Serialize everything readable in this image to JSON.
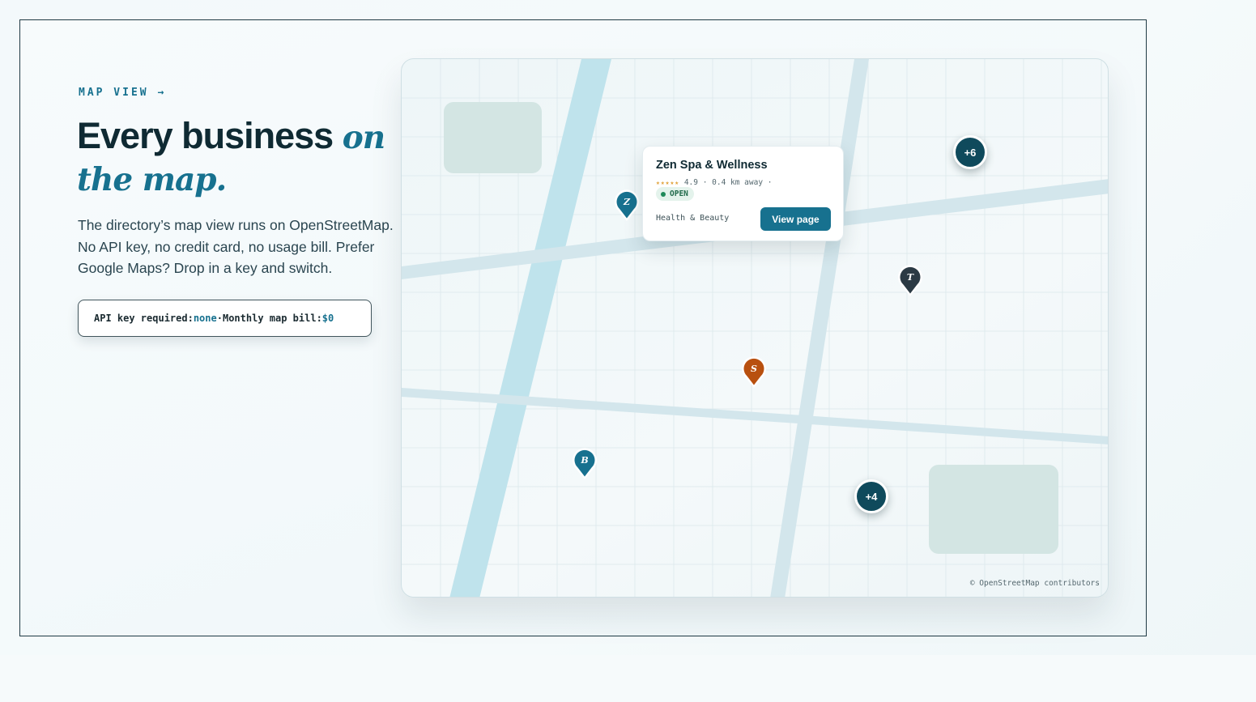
{
  "section": {
    "eyebrow": "MAP VIEW →",
    "headline_main": "Every business ",
    "headline_accent": "on the map.",
    "description": "The directory’s map view runs on OpenStreetMap. No API key, no credit card, no usage bill. Prefer Google Maps? Drop in a key and switch.",
    "info": {
      "api_label": "API key required: ",
      "api_value": "none",
      "separator": " · ",
      "bill_label": "Monthly map bill: ",
      "bill_value": "$0"
    }
  },
  "map": {
    "popup": {
      "title": "Zen Spa & Wellness",
      "stars": "★★★★★",
      "meta": " 4.9 · 0.4 km away ·",
      "status": "OPEN",
      "category": "Health & Beauty",
      "button_label": "View page"
    },
    "markers": [
      {
        "letter": "Z",
        "color": "#17718f"
      },
      {
        "letter": "T",
        "color": "#2b3a44"
      },
      {
        "letter": "S",
        "color": "#b8500f"
      },
      {
        "letter": "B",
        "color": "#17718f"
      }
    ],
    "clusters": [
      {
        "label": "+6"
      },
      {
        "label": "+4"
      }
    ],
    "attribution": "© OpenStreetMap contributors"
  },
  "colors": {
    "accent": "#17718f",
    "ink": "#0f2a33",
    "open_green": "#1f8a5a",
    "star_gold": "#e0a23a"
  }
}
